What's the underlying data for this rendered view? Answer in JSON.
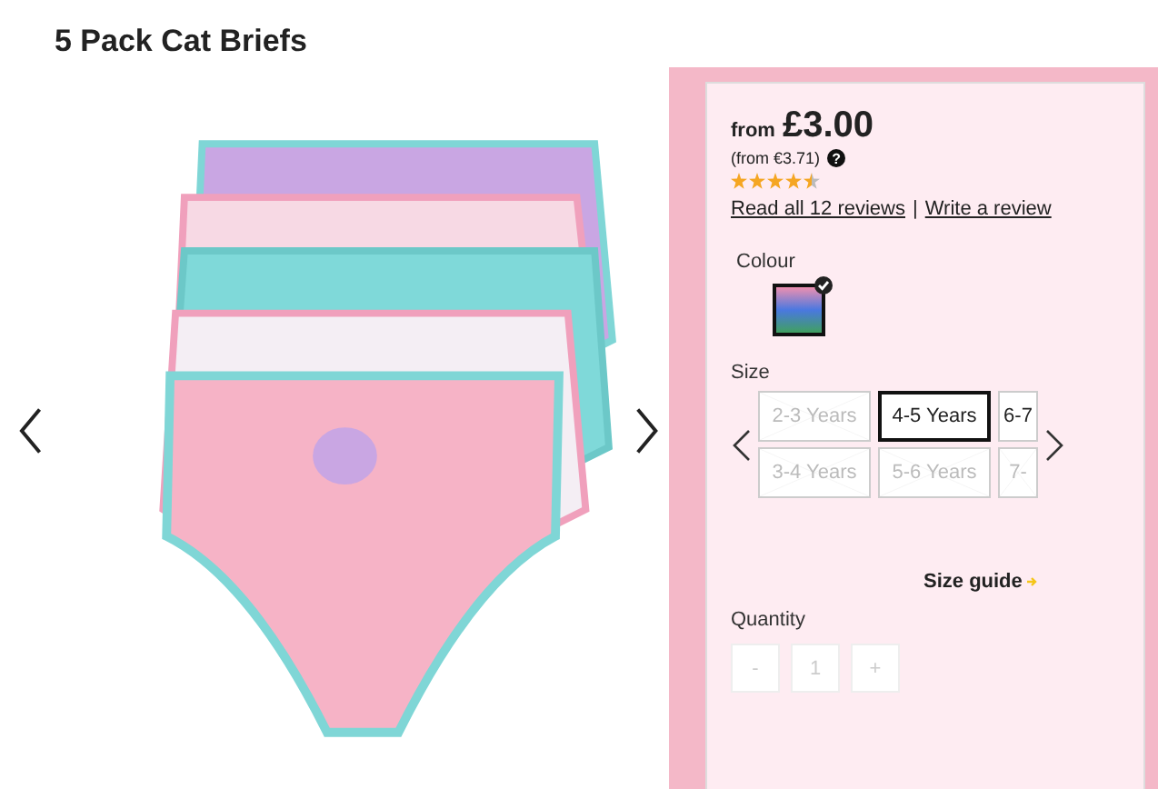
{
  "title": "5 Pack Cat Briefs",
  "price": {
    "prefix": "from",
    "amount": "£3.00",
    "alt": "(from €3.71)",
    "help": "?"
  },
  "rating": {
    "stars": 4.5
  },
  "reviews": {
    "read": "Read all 12 reviews",
    "separator": "|",
    "write": "Write a review"
  },
  "colour": {
    "label": "Colour",
    "swatches": [
      {
        "selected": true
      }
    ]
  },
  "size": {
    "label": "Size",
    "options": [
      {
        "label": "2-3 Years",
        "available": false,
        "selected": false
      },
      {
        "label": "4-5 Years",
        "available": true,
        "selected": true
      },
      {
        "label": "6-7",
        "available": true,
        "selected": false
      },
      {
        "label": "3-4 Years",
        "available": false,
        "selected": false
      },
      {
        "label": "5-6 Years",
        "available": false,
        "selected": false
      },
      {
        "label": "7-",
        "available": false,
        "selected": false
      }
    ]
  },
  "size_guide": "Size guide",
  "quantity": {
    "label": "Quantity",
    "minus": "-",
    "value": "1",
    "plus": "+"
  }
}
